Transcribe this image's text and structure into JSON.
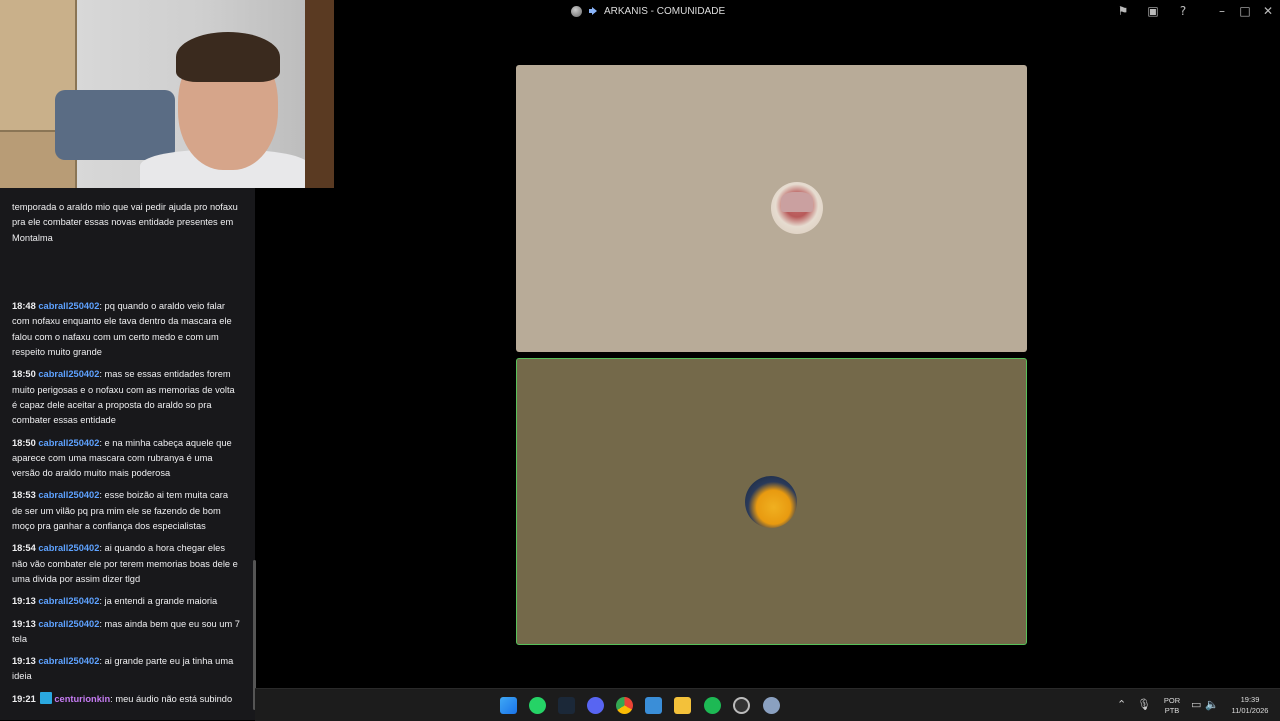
{
  "window": {
    "title": "ARKANIS - COMUNIDADE"
  },
  "chat": {
    "fragment_lines": "temporada o araldo mio que vai pedir ajuda pro nofaxu pra ele combater essas novas entidade presentes em Montalma",
    "messages": [
      {
        "time": "18:48",
        "user": "cabrall250402",
        "text": ": pq quando o araldo veio falar com nofaxu enquanto ele tava dentro da mascara ele falou com o nafaxu com um certo medo e com um respeito muito grande"
      },
      {
        "time": "18:50",
        "user": "cabrall250402",
        "text": ": mas se essas entidades forem muito perigosas e o nofaxu com as memorias de volta é capaz dele aceitar a proposta do araldo so pra combater essas entidade"
      },
      {
        "time": "18:50",
        "user": "cabrall250402",
        "text": ": e na minha cabeça aquele que aparece com uma mascara com rubranya é uma versão do araldo muito mais poderosa"
      },
      {
        "time": "18:53",
        "user": "cabrall250402",
        "text": ": esse boizão ai tem muita cara de ser um vilão pq pra mim ele se fazendo de bom moço pra ganhar a confiança dos especialistas"
      },
      {
        "time": "18:54",
        "user": "cabrall250402",
        "text": ": ai quando a hora chegar eles não vão combater ele por terem memorias boas dele e uma divida por assim dizer tlgd"
      },
      {
        "time": "19:13",
        "user": "cabrall250402",
        "text": ": ja entendi a grande maioria"
      },
      {
        "time": "19:13",
        "user": "cabrall250402",
        "text": ": mas ainda bem que eu sou um 7 tela"
      },
      {
        "time": "19:13",
        "user": "cabrall250402",
        "text": ": ai grande parte eu ja tinha uma ideia"
      },
      {
        "time": "19:21",
        "user": "centurionkin",
        "text": ": meu áudio não está subindo"
      }
    ]
  },
  "taskbar": {
    "lang_top": "POR",
    "lang_bottom": "PTB",
    "time": "19:39",
    "date": "11/01/2026"
  },
  "colors": {
    "tile_top": "#b8ab98",
    "tile_bottom": "#74694a",
    "speaking_border": "#57c15a",
    "username": "#5ea2ff"
  }
}
